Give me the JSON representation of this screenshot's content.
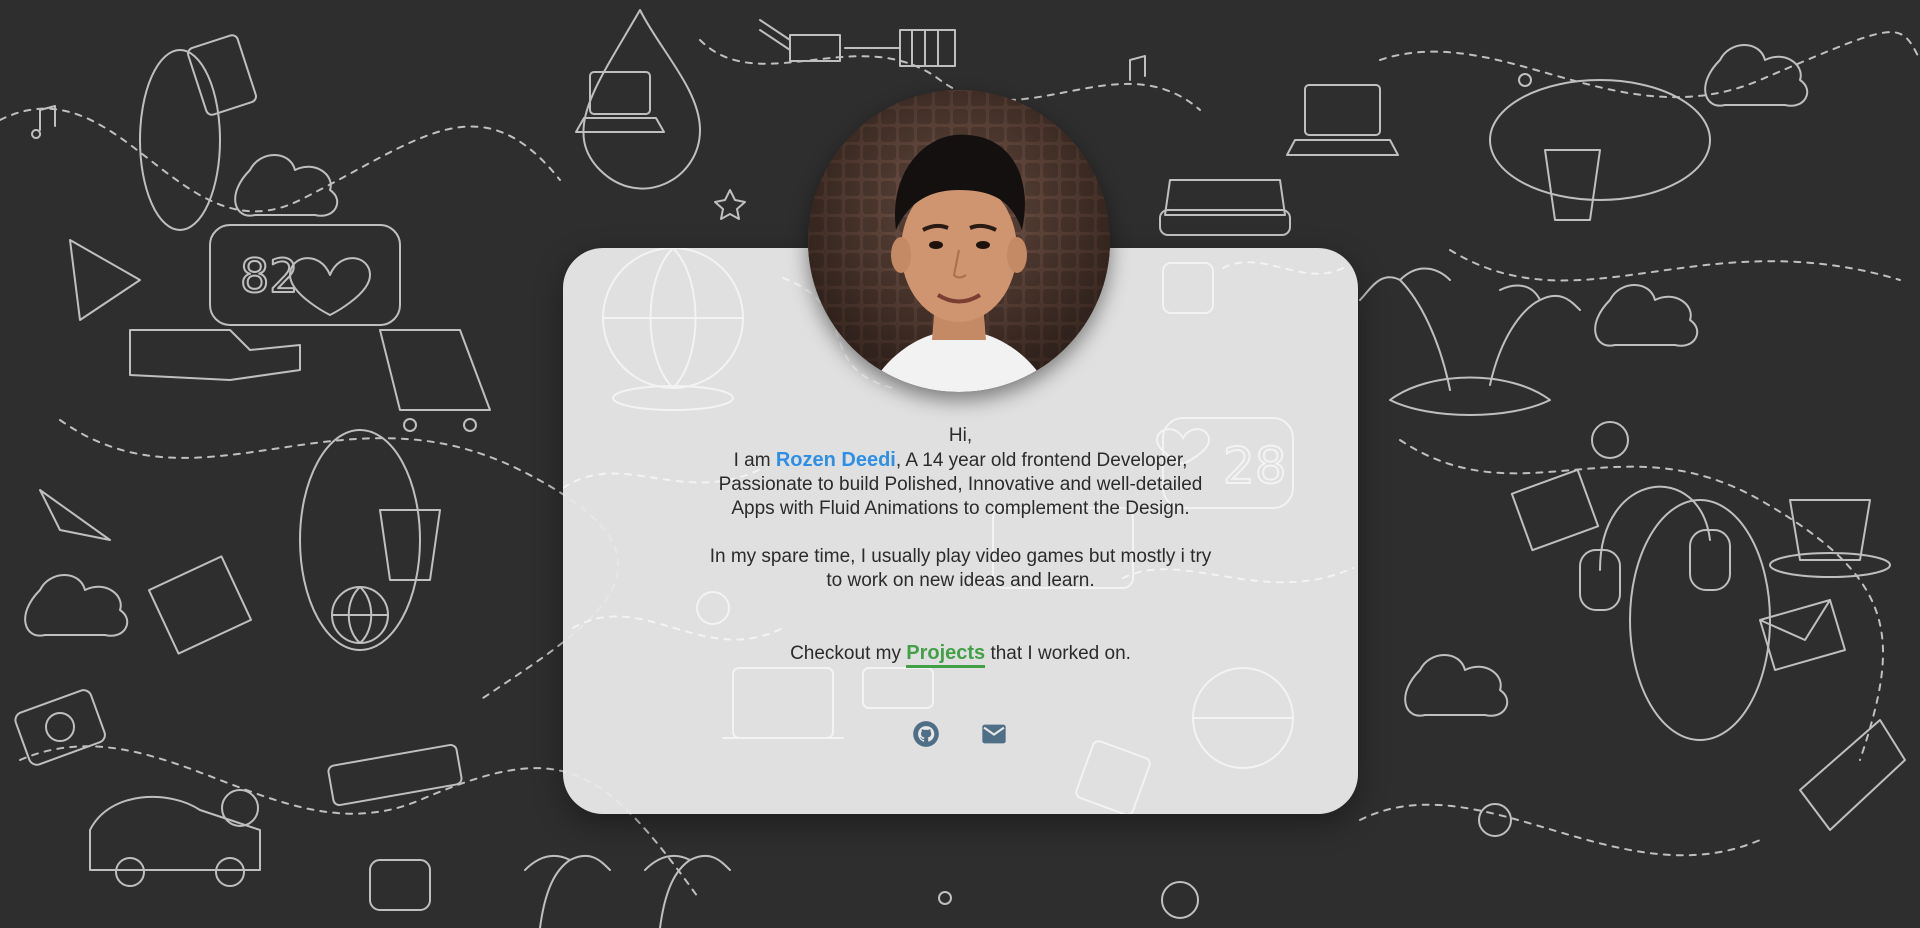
{
  "profile": {
    "greeting": "Hi,",
    "intro_prefix": "I am ",
    "name": "Rozen Deedi",
    "intro_suffix": ", A 14 year old frontend Developer,",
    "line2": "Passionate to build Polished, Innovative and well-detailed",
    "line3": "Apps with Fluid Animations to complement the Design.",
    "spare_line1": "In my spare time, I usually play video games but mostly i try",
    "spare_line2": "to work on new ideas and learn.",
    "avatar_alt": "profile-photo"
  },
  "cta": {
    "prefix": "Checkout my ",
    "link_label": "Projects",
    "suffix": " that I worked on."
  },
  "socials": [
    {
      "name": "github",
      "icon": "github-icon"
    },
    {
      "name": "email",
      "icon": "mail-icon"
    }
  ],
  "colors": {
    "background": "#2e2e2e",
    "card": "#e8e8e8",
    "name_accent": "#2f8fe6",
    "link_accent": "#43a047",
    "icon": "#4f6f86"
  }
}
